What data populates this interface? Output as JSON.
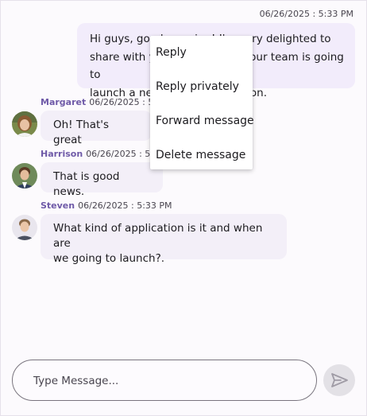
{
  "outgoing": {
    "timestamp": "06/26/2025 : 5:33 PM",
    "lines": [
      "Hi guys, good morning! I'm very delighted to",
      "share with you the news that our team is going to",
      "launch a new mobile application."
    ]
  },
  "messages": [
    {
      "author": "Margaret",
      "time": "06/26/2025 : 5:33 PM",
      "lines": [
        "Oh! That's great"
      ]
    },
    {
      "author": "Harrison",
      "time": "06/26/2025 : 5:33 PM",
      "lines": [
        "That is good news."
      ]
    },
    {
      "author": "Steven",
      "time": "06/26/2025 : 5:33 PM",
      "lines": [
        "What kind of application is it and when are",
        "we going to launch?."
      ]
    }
  ],
  "context_menu": {
    "items": [
      "Reply",
      "Reply privately",
      "Forward message",
      "Delete message"
    ]
  },
  "composer": {
    "placeholder": "Type Message...",
    "send_icon": "send-icon"
  },
  "colors": {
    "accent": "#6f5aa8",
    "bubble_outgoing": "#f2ecfb",
    "bubble_incoming": "#f3eff8",
    "send_button_bg": "#e3e1e6"
  }
}
